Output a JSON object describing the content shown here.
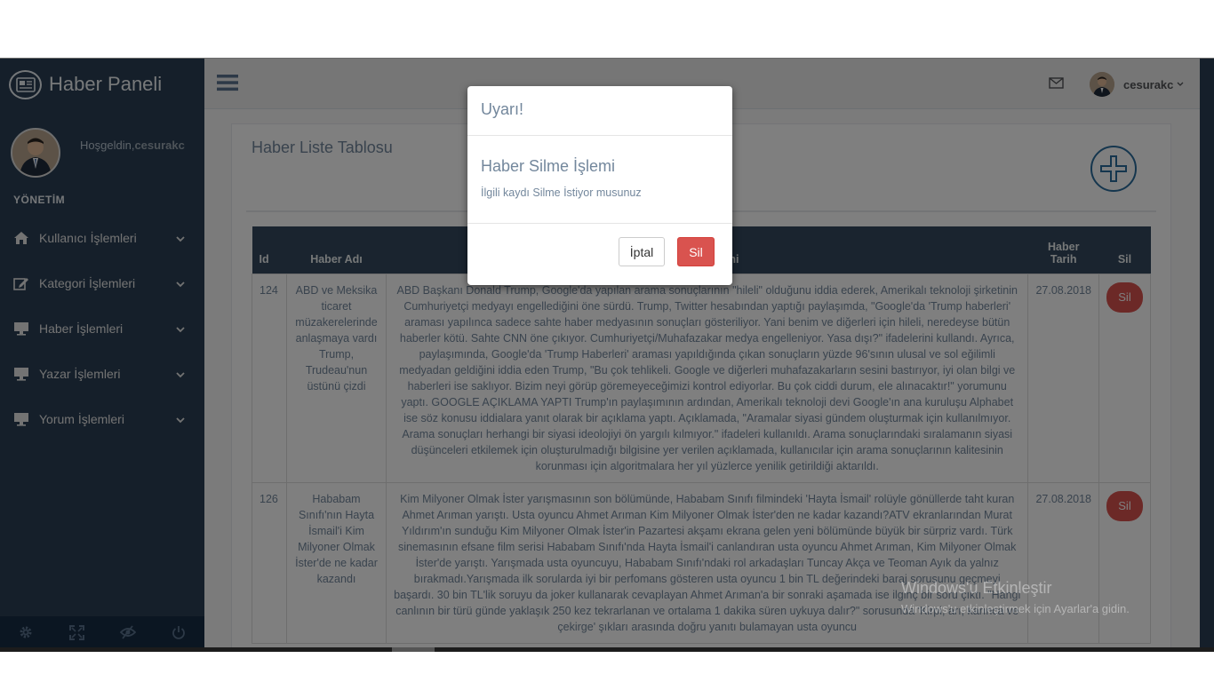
{
  "sidebar": {
    "brand_title": "Haber Paneli",
    "welcome_prefix": "Hoşgeldin,",
    "welcome_user": "cesurakc",
    "section_title": "YÖNETİM",
    "items": [
      {
        "label": "Kullanıcı İşlemleri",
        "icon": "home-icon"
      },
      {
        "label": "Kategori İşlemleri",
        "icon": "edit-icon"
      },
      {
        "label": "Haber İşlemleri",
        "icon": "desktop-icon"
      },
      {
        "label": "Yazar İşlemleri",
        "icon": "desktop-icon"
      },
      {
        "label": "Yorum İşlemleri",
        "icon": "desktop-icon"
      }
    ],
    "footer_icons": [
      "gear-icon",
      "fullscreen-icon",
      "eye-slash-icon",
      "power-icon"
    ]
  },
  "topnav": {
    "user_name": "cesurakc"
  },
  "panel": {
    "title": "Haber Liste Tablosu"
  },
  "table": {
    "headers": {
      "id": "Id",
      "name": "Haber Adı",
      "text": "Haber Metni",
      "date_line1": "Haber",
      "date_line2": "Tarih",
      "delete": "Sil"
    },
    "rows": [
      {
        "id": "124",
        "name": "ABD ve Meksika ticaret müzakerelerinde anlaşmaya vardı Trump, Trudeau'nun üstünü çizdi",
        "text": "ABD Başkanı Donald Trump, Google'da yapılan arama sonuçlarının \"hileli\" olduğunu iddia ederek, Amerikalı teknoloji şirketinin Cumhuriyetçi medyayı engellediğini öne sürdü. Trump, Twitter hesabından yaptığı paylaşımda, \"Google'da 'Trump haberleri' araması yapılınca sadece sahte haber medyasının sonuçları gösteriliyor. Yani benim ve diğerleri için hileli, neredeyse bütün haberler kötü. Sahte CNN öne çıkıyor. Cumhuriyetçi/Muhafazakar medya engelleniyor. Yasa dışı?\" ifadelerini kullandı. Ayrıca, paylaşımında, Google'da 'Trump Haberleri' araması yapıldığında çıkan sonuçların yüzde 96'sının ulusal ve sol eğilimli medyadan geldiğini iddia eden Trump, \"Bu çok tehlikeli. Google ve diğerleri muhafazakarların sesini bastırıyor, iyi olan bilgi ve haberleri ise saklıyor. Bizim neyi görüp göremeyeceğimizi kontrol ediyorlar. Bu çok ciddi durum, ele alınacaktır!\" yorumunu yaptı. GOOGLE AÇIKLAMA YAPTI Trump'ın paylaşımının ardından, Amerikalı teknoloji devi Google'ın ana kuruluşu Alphabet ise söz konusu iddialara yanıt olarak bir açıklama yaptı. Açıklamada, \"Aramalar siyasi gündem oluşturmak için kullanılmıyor. Arama sonuçları herhangi bir siyasi ideolojiyi ön yargılı kılmıyor.\" ifadeleri kullanıldı. Arama sonuçlarındaki sıralamanın siyasi düşünceleri etkilemek için oluşturulmadığı bilgisine yer verilen açıklamada, kullanıcılar için arama sonuçlarının kalitesinin korunması için algoritmalara her yıl yüzlerce yenilik getirildiği aktarıldı.",
        "date": "27.08.2018",
        "delete_label": "Sil"
      },
      {
        "id": "126",
        "name": "Hababam Sınıfı'nın Hayta İsmail'i Kim Milyoner Olmak İster'de ne kadar kazandı",
        "text": "Kim Milyoner Olmak İster yarışmasının son bölümünde, Hababam Sınıfı filmindeki 'Hayta İsmail' rolüyle gönüllerde taht kuran Ahmet Arıman yarıştı. Usta oyuncu Ahmet Arıman Kim Milyoner Olmak İster'den ne kadar kazandı?ATV ekranlarından Murat Yıldırım'ın sunduğu Kim Milyoner Olmak İster'in Pazartesi akşamı ekrana gelen yeni bölümünde büyük bir sürpriz vardı. Türk sinemasının efsane film serisi Hababam Sınıfı'nda Hayta İsmail'i canlandıran usta oyuncu Ahmet Arıman, Kim Milyoner Olmak İster'de yarıştı. Yarışmada usta oyuncuyu, Hababam Sınıfı'ndaki rol arkadaşları Tuncay Akça ve Teoman Ayık da yalnız bırakmadı.Yarışmada ilk sorularda iyi bir perfomans gösteren usta oyuncu 1 bin TL değerindeki baraj sorusunu geçmeyi başardı. 30 bin TL'lik soruyu da joker kullanarak cevaplayan Ahmet Arıman'a bir sonraki aşamada ise ilginç bir soru çıktı. \"Hangi canlının bir türü günde yaklaşık 250 kez tekrarlanan ve ortalama 1 dakika süren uykuya dalır?\" sorusunda 'Kirpi, arı, karınca ve çekirge' şıkları arasında doğru yanıtı bulamayan usta oyuncu",
        "date": "27.08.2018",
        "delete_label": "Sil"
      }
    ]
  },
  "modal": {
    "header": "Uyarı!",
    "body_title": "Haber Silme İşlemi",
    "body_text": "İlgili kaydı Silme İstiyor musunuz",
    "cancel_label": "İptal",
    "delete_label": "Sil"
  },
  "watermark": {
    "title": "Windows'u Etkinleştir",
    "subtitle": "Windows'u etkinleştirmek için Ayarlar'a gidin."
  },
  "colors": {
    "sidebar": "#2a3f54",
    "table_header": "#34495e",
    "danger": "#d9534f",
    "text_muted": "#73879c"
  }
}
